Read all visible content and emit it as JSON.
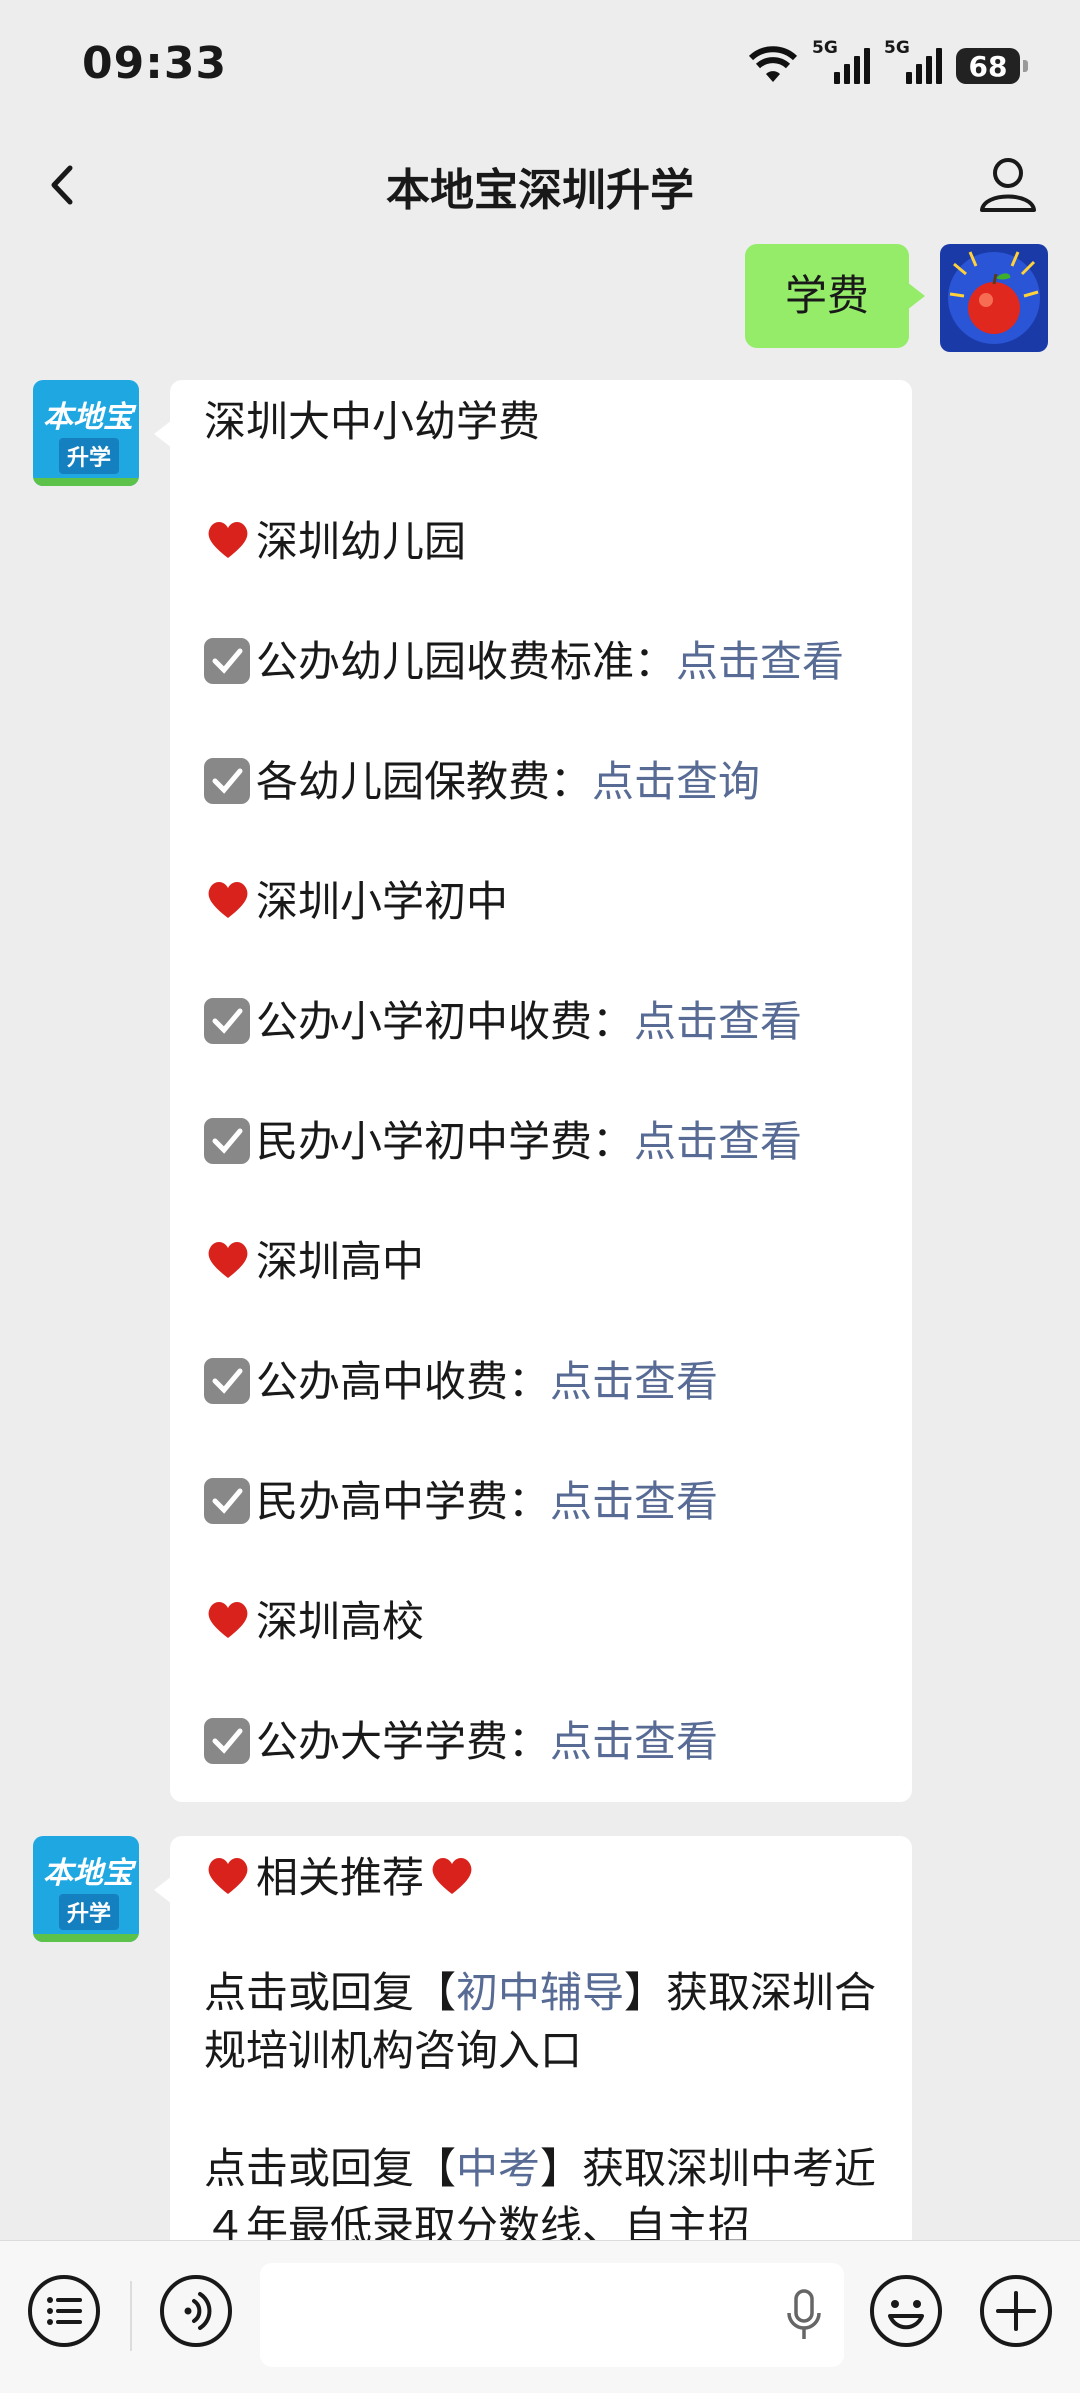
{
  "status": {
    "time": "09:33",
    "sig1": "5G",
    "sig2": "5G",
    "battery": "68"
  },
  "nav": {
    "title": "本地宝深圳升学"
  },
  "user_msg": {
    "text": "学费"
  },
  "msg1": {
    "title": "深圳大中小幼学费",
    "sections": [
      {
        "heading": "深圳幼儿园",
        "items": [
          {
            "label": "公办幼儿园收费标准：",
            "link": "点击查看"
          },
          {
            "label": "各幼儿园保教费：",
            "link": "点击查询"
          }
        ]
      },
      {
        "heading": "深圳小学初中",
        "items": [
          {
            "label": "公办小学初中收费：",
            "link": "点击查看"
          },
          {
            "label": "民办小学初中学费：",
            "link": "点击查看"
          }
        ]
      },
      {
        "heading": "深圳高中",
        "items": [
          {
            "label": "公办高中收费：",
            "link": "点击查看"
          },
          {
            "label": "民办高中学费：",
            "link": "点击查看"
          }
        ]
      },
      {
        "heading": "深圳高校",
        "items": [
          {
            "label": "公办大学学费：",
            "link": "点击查看"
          }
        ]
      }
    ]
  },
  "msg2": {
    "heading": "相关推荐",
    "p1": {
      "pre": "点击或回复【",
      "link": "初中辅导",
      "post": "】获取深圳合规培训机构咨询入口"
    },
    "p2": {
      "pre": "点击或回复【",
      "link": "中考",
      "post": "】获取深圳中考近４年最低录取分数线、自主招"
    }
  },
  "account_logo": {
    "top": "本地宝",
    "bottom": "升学"
  },
  "icons": [
    "back-icon",
    "profile-icon",
    "heart-icon",
    "checkbox-icon",
    "menu-icon",
    "voice-icon",
    "mic-icon",
    "emoji-icon",
    "plus-icon"
  ]
}
